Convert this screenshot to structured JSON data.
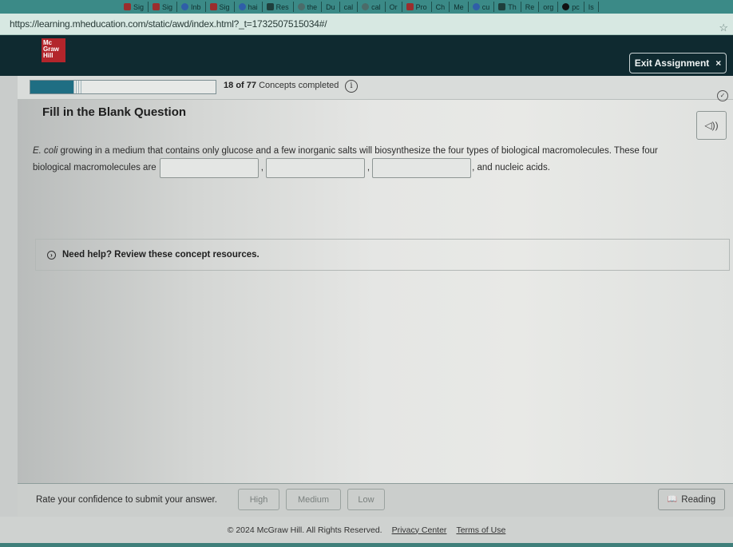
{
  "browser": {
    "bookmarks": [
      {
        "label": "Sig",
        "icon": "red"
      },
      {
        "label": "Sig",
        "icon": "red"
      },
      {
        "label": "Inb",
        "icon": "blue"
      },
      {
        "label": "Sig",
        "icon": "red"
      },
      {
        "label": "hai",
        "icon": "blue"
      },
      {
        "label": "Res",
        "icon": "dark"
      },
      {
        "label": "the",
        "icon": "gray"
      },
      {
        "label": "Du",
        "icon": ""
      },
      {
        "label": "cal",
        "icon": ""
      },
      {
        "label": "cal",
        "icon": "gray"
      },
      {
        "label": "Or",
        "icon": ""
      },
      {
        "label": "Pro",
        "icon": "red"
      },
      {
        "label": "Ch",
        "icon": ""
      },
      {
        "label": "Me",
        "icon": ""
      },
      {
        "label": "cu",
        "icon": "blue"
      },
      {
        "label": "Th",
        "icon": "dark"
      },
      {
        "label": "Re",
        "icon": ""
      },
      {
        "label": "org",
        "icon": ""
      },
      {
        "label": "pc",
        "icon": "black"
      },
      {
        "label": "Is",
        "icon": ""
      }
    ],
    "url": "https://learning.mheducation.com/static/awd/index.html?_t=1732507515034#/",
    "bookmark_star_icon": "star-icon"
  },
  "header": {
    "logo_lines": [
      "Mc",
      "Graw",
      "Hill"
    ],
    "exit_label": "Exit Assignment",
    "exit_icon": "×"
  },
  "progress": {
    "completed": "18",
    "total": "77",
    "of_word": "of",
    "suffix": "Concepts completed",
    "fraction": 0.234,
    "info_icon": "i"
  },
  "question": {
    "title": "Fill in the Blank Question",
    "audio_icon": "◁))",
    "sentence_italic": "E. coli",
    "sentence_part1": " growing in a medium that contains only glucose and a few inorganic salts will biosynthesize the four types of biological macromolecules. These four",
    "sentence_part2_prefix": "biological macromolecules are",
    "blanks": [
      {
        "value": "",
        "placeholder": ""
      },
      {
        "value": "",
        "placeholder": ""
      },
      {
        "value": "",
        "placeholder": ""
      }
    ],
    "separator": ",",
    "sentence_suffix": ", and nucleic acids."
  },
  "help": {
    "icon": "›",
    "label": "Need help? Review these concept resources."
  },
  "confidence": {
    "prompt": "Rate your confidence to submit your answer.",
    "options": [
      "High",
      "Medium",
      "Low"
    ]
  },
  "reading": {
    "label": "Reading",
    "icon": "📖"
  },
  "footer": {
    "copyright": "© 2024 McGraw Hill. All Rights Reserved.",
    "privacy": "Privacy Center",
    "terms": "Terms of Use"
  }
}
